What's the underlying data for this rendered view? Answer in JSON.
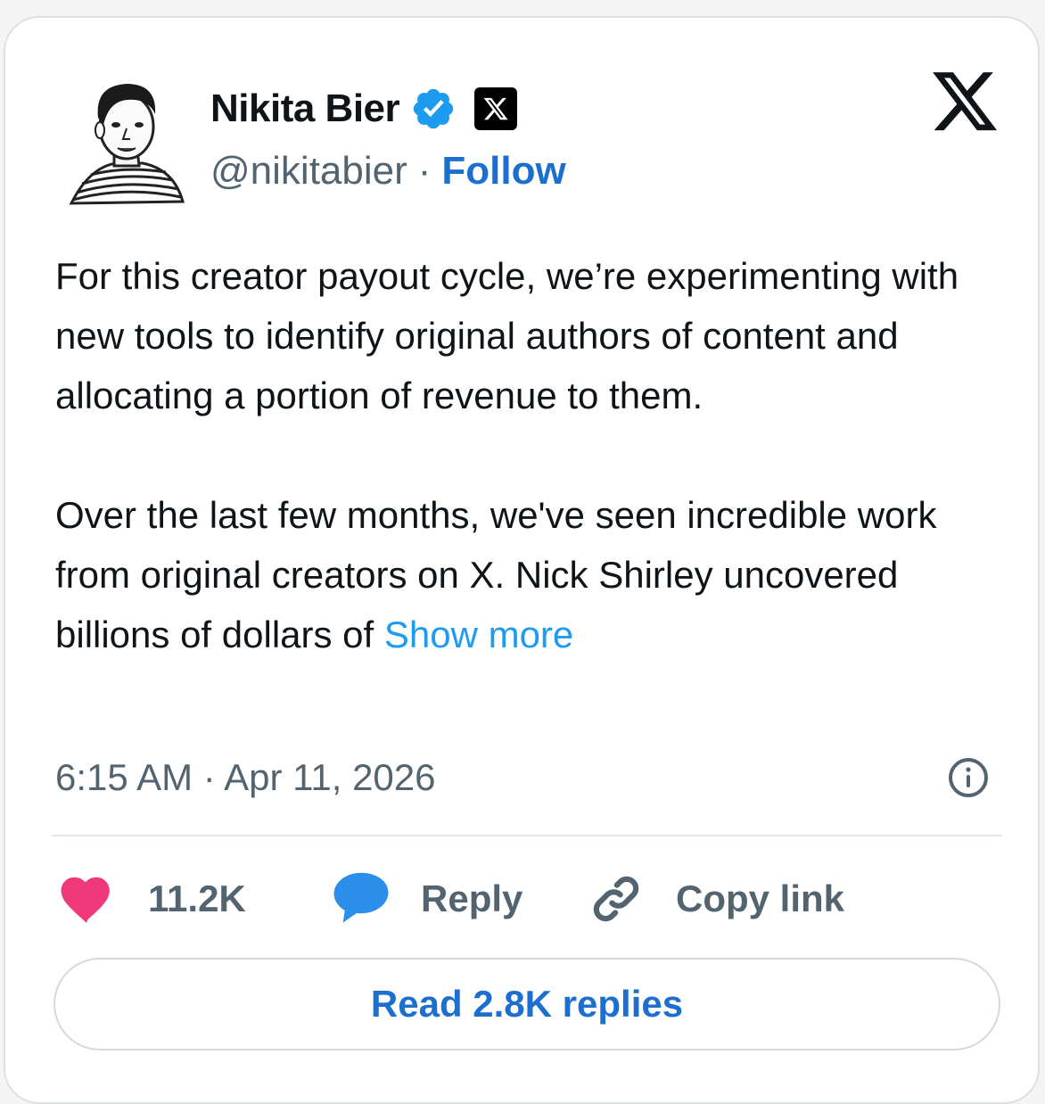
{
  "author": {
    "name": "Nikita Bier",
    "handle": "@nikitabier",
    "separator": "·",
    "follow_label": "Follow"
  },
  "tweet": {
    "paragraph1": "For this creator payout cycle, we’re experimenting with new tools to identify original authors of content and allocating a portion of revenue to them.",
    "paragraph2": "Over the last few months, we've seen incredible work from original creators on X. Nick Shirley uncovered billions of dollars of",
    "show_more_label": "Show more",
    "timestamp": "6:15 AM · Apr 11, 2026"
  },
  "actions": {
    "likes": "11.2K",
    "reply_label": "Reply",
    "copy_link_label": "Copy link"
  },
  "footer": {
    "read_replies_label": "Read 2.8K replies"
  },
  "icons": {
    "verified": "verified-badge-icon",
    "affiliate": "x-affiliate-icon",
    "brand": "x-logo-icon",
    "info": "info-icon",
    "like": "heart-icon",
    "reply": "speech-bubble-icon",
    "copy": "link-icon"
  },
  "colors": {
    "link": "#1d6fcf",
    "show_more": "#1d9bf0",
    "heart": "#f0397a",
    "bubble": "#2b8ee8",
    "verified": "#1d9bf0",
    "muted": "#536471"
  }
}
